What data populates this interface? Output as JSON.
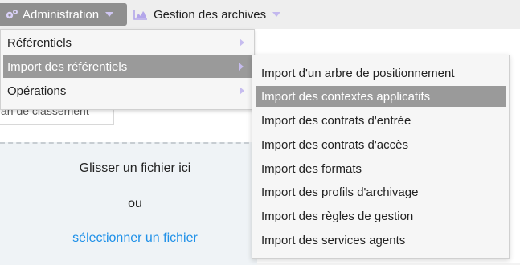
{
  "navbar": {
    "admin_label": "Administration",
    "admin_icon": "cogs-icon",
    "archives_label": "Gestion des archives",
    "archives_icon": "area-chart-icon"
  },
  "admin_menu": {
    "items": [
      {
        "label": "Référentiels",
        "active": false
      },
      {
        "label": "Import des référentiels",
        "active": true
      },
      {
        "label": "Opérations",
        "active": false
      }
    ]
  },
  "import_submenu": {
    "items": [
      {
        "label": "Import d'un arbre de positionnement",
        "active": false
      },
      {
        "label": "Import des contextes applicatifs",
        "active": true
      },
      {
        "label": "Import des contrats d'entrée",
        "active": false
      },
      {
        "label": "Import des contrats d'accès",
        "active": false
      },
      {
        "label": "Import des formats",
        "active": false
      },
      {
        "label": "Import des profils d'archivage",
        "active": false
      },
      {
        "label": "Import des règles de gestion",
        "active": false
      },
      {
        "label": "Import des services agents",
        "active": false
      }
    ]
  },
  "page": {
    "plan_button_label": "an de classement",
    "drop_zone": {
      "line1": "Glisser un fichier ici",
      "line2": "ou",
      "link": "sélectionner un fichier"
    }
  },
  "colors": {
    "menu_active": "#9a9a9a",
    "link": "#1e90e8",
    "caret": "#c6bcef"
  }
}
